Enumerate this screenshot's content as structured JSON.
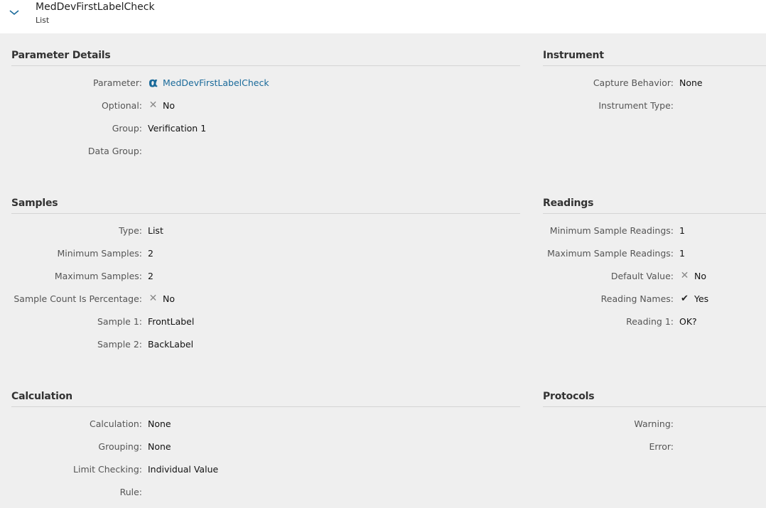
{
  "header": {
    "title": "MedDevFirstLabelCheck",
    "subtitle": "List"
  },
  "sections": [
    {
      "id": "parameter-details",
      "title": "Parameter Details",
      "rows": [
        {
          "label": "Parameter:",
          "value": "MedDevFirstLabelCheck",
          "icon": "alpha-icon",
          "link": true
        },
        {
          "label": "Optional:",
          "value": "No",
          "icon": "x-icon"
        },
        {
          "label": "Group:",
          "value": "Verification 1"
        },
        {
          "label": "Data Group:",
          "value": ""
        }
      ]
    },
    {
      "id": "instrument",
      "title": "Instrument",
      "rows": [
        {
          "label": "Capture Behavior:",
          "value": "None"
        },
        {
          "label": "Instrument Type:",
          "value": ""
        }
      ]
    },
    {
      "id": "samples",
      "title": "Samples",
      "rows": [
        {
          "label": "Type:",
          "value": "List"
        },
        {
          "label": "Minimum Samples:",
          "value": "2"
        },
        {
          "label": "Maximum Samples:",
          "value": "2"
        },
        {
          "label": "Sample Count Is Percentage:",
          "value": "No",
          "icon": "x-icon"
        },
        {
          "label": "Sample 1:",
          "value": "FrontLabel"
        },
        {
          "label": "Sample 2:",
          "value": "BackLabel"
        }
      ]
    },
    {
      "id": "readings",
      "title": "Readings",
      "rows": [
        {
          "label": "Minimum Sample Readings:",
          "value": "1"
        },
        {
          "label": "Maximum Sample Readings:",
          "value": "1"
        },
        {
          "label": "Default Value:",
          "value": "No",
          "icon": "x-icon"
        },
        {
          "label": "Reading Names:",
          "value": "Yes",
          "icon": "check-icon"
        },
        {
          "label": "Reading 1:",
          "value": "OK?"
        }
      ]
    },
    {
      "id": "calculation",
      "title": "Calculation",
      "rows": [
        {
          "label": "Calculation:",
          "value": "None"
        },
        {
          "label": "Grouping:",
          "value": "None"
        },
        {
          "label": "Limit Checking:",
          "value": "Individual Value"
        },
        {
          "label": "Rule:",
          "value": ""
        }
      ]
    },
    {
      "id": "protocols",
      "title": "Protocols",
      "rows": [
        {
          "label": "Warning:",
          "value": ""
        },
        {
          "label": "Error:",
          "value": ""
        }
      ]
    }
  ]
}
